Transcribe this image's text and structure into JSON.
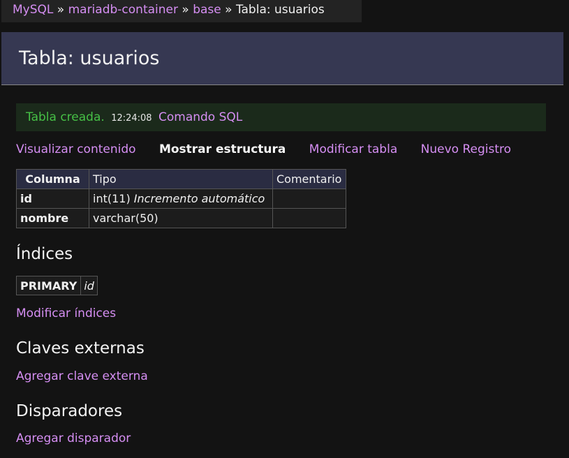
{
  "breadcrumb": {
    "items": [
      "MySQL",
      "mariadb-container",
      "base"
    ],
    "separator": "»",
    "current": "Tabla: usuarios"
  },
  "header": {
    "title": "Tabla: usuarios"
  },
  "message": {
    "text": "Tabla creada.",
    "time": "12:24:08",
    "link": "Comando SQL"
  },
  "menu": {
    "view": "Visualizar contenido",
    "structure": "Mostrar estructura",
    "alter": "Modificar tabla",
    "new_item": "Nuevo Registro"
  },
  "structure_table": {
    "headers": [
      "Columna",
      "Tipo",
      "Comentario"
    ],
    "rows": [
      {
        "name": "id",
        "type": "int(11)",
        "extra": "Incremento automático",
        "comment": ""
      },
      {
        "name": "nombre",
        "type": "varchar(50)",
        "extra": "",
        "comment": ""
      }
    ]
  },
  "indexes": {
    "title": "Índices",
    "rows": [
      {
        "type": "PRIMARY",
        "columns": "id"
      }
    ],
    "alter_link": "Modificar índices"
  },
  "foreign_keys": {
    "title": "Claves externas",
    "add_link": "Agregar clave externa"
  },
  "triggers": {
    "title": "Disparadores",
    "add_link": "Agregar disparador"
  },
  "colors": {
    "background": "#131313",
    "link": "#d58ef2",
    "header_bg": "#363852",
    "success": "#46c046"
  }
}
